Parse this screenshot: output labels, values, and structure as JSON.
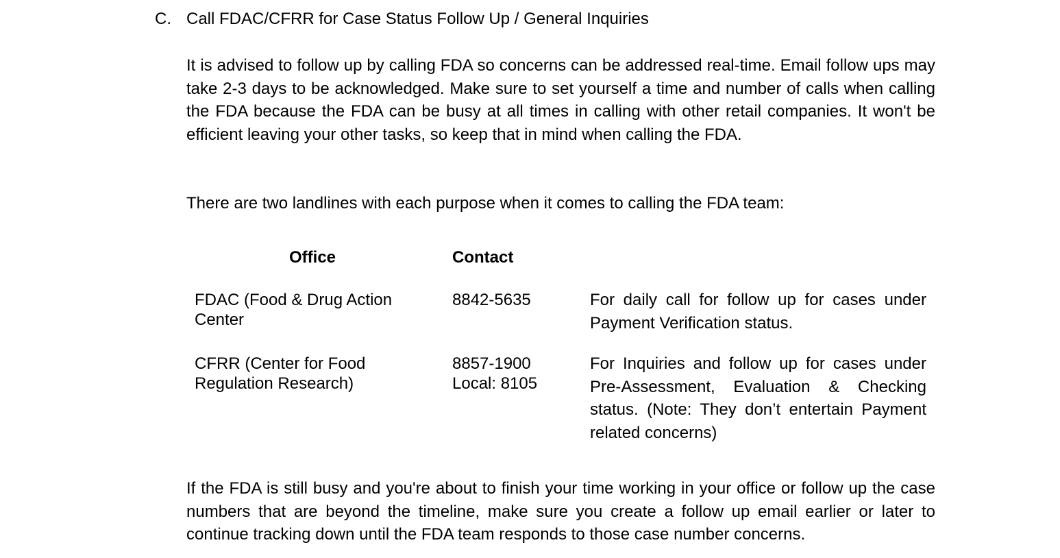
{
  "section": {
    "letter": "C.",
    "title": "Call FDAC/CFRR for Case Status Follow Up / General Inquiries"
  },
  "paragraphs": {
    "intro": "It is advised to follow up by calling FDA so concerns can be addressed real-time. Email follow ups may take 2-3 days to be acknowledged. Make sure to set yourself a time and number of calls when calling the FDA because the FDA can be busy at all times in calling with other retail companies. It won't be efficient leaving your other tasks, so keep that in mind when calling the FDA.",
    "landlines": "There are two landlines with each purpose when it comes to calling the FDA team:",
    "closing": "If the FDA is still busy and you're about to finish your time working in your office or follow up the case numbers that are beyond the timeline, make sure you create a follow up email earlier or later to continue tracking down until the FDA team responds to those case number concerns."
  },
  "table": {
    "headers": {
      "office": "Office",
      "contact": "Contact"
    },
    "rows": [
      {
        "office": "FDAC (Food & Drug Action Center",
        "contact_line1": "8842-5635",
        "contact_line2": "",
        "description": "For daily call for follow up for cases under Payment Verification status."
      },
      {
        "office": "CFRR (Center for Food Regulation Research)",
        "contact_line1": "8857-1900",
        "contact_line2": "Local: 8105",
        "description": "For Inquiries and follow up for cases under Pre-Assessment, Evaluation & Checking status. (Note: They don’t entertain Payment related concerns)"
      }
    ]
  }
}
